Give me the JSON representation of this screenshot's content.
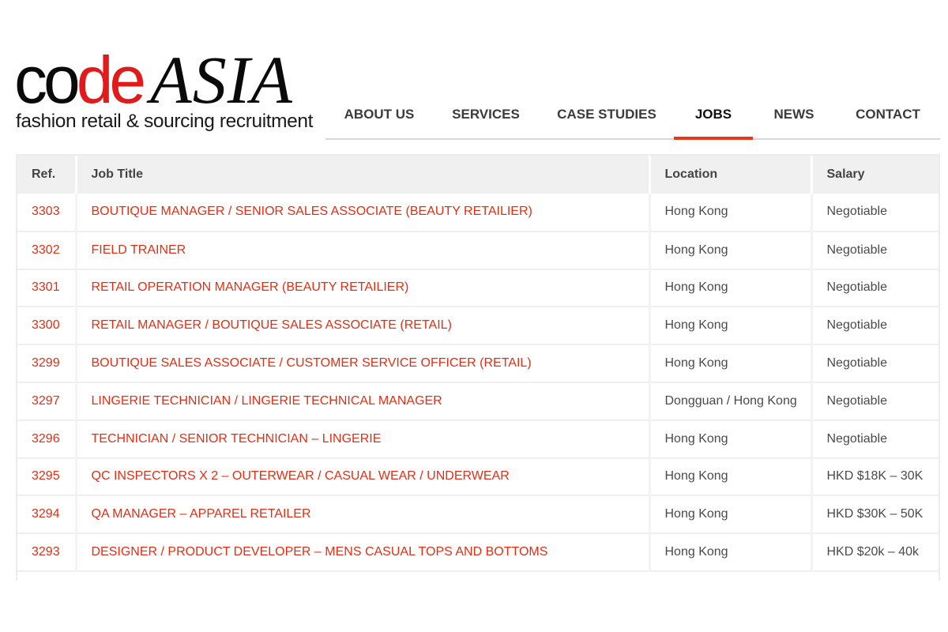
{
  "logo": {
    "code_part1": "co",
    "code_part2": "de",
    "asia": "ASIA",
    "tagline": "fashion retail & sourcing recruitment"
  },
  "nav": {
    "items": [
      {
        "label": "ABOUT US",
        "active": false
      },
      {
        "label": "SERVICES",
        "active": false
      },
      {
        "label": "CASE STUDIES",
        "active": false
      },
      {
        "label": "JOBS",
        "active": true
      },
      {
        "label": "NEWS",
        "active": false
      },
      {
        "label": "CONTACT",
        "active": false
      }
    ]
  },
  "colors": {
    "accent": "#e5391c",
    "link": "#e32e14",
    "header_bg": "#f0f0f0"
  },
  "jobs_table": {
    "headers": [
      "Ref.",
      "Job Title",
      "Location",
      "Salary"
    ],
    "rows": [
      {
        "ref": "3303",
        "title": "BOUTIQUE MANAGER / SENIOR SALES ASSOCIATE (BEAUTY RETAILIER)",
        "location": "Hong Kong",
        "salary": "Negotiable"
      },
      {
        "ref": "3302",
        "title": "FIELD TRAINER",
        "location": "Hong Kong",
        "salary": "Negotiable"
      },
      {
        "ref": "3301",
        "title": "RETAIL OPERATION MANAGER (BEAUTY RETAILIER)",
        "location": "Hong Kong",
        "salary": "Negotiable"
      },
      {
        "ref": "3300",
        "title": "RETAIL MANAGER / BOUTIQUE SALES ASSOCIATE (RETAIL)",
        "location": "Hong Kong",
        "salary": "Negotiable"
      },
      {
        "ref": "3299",
        "title": "BOUTIQUE SALES ASSOCIATE / CUSTOMER SERVICE OFFICER (RETAIL)",
        "location": "Hong Kong",
        "salary": "Negotiable"
      },
      {
        "ref": "3297",
        "title": "LINGERIE TECHNICIAN / LINGERIE TECHNICAL MANAGER",
        "location": "Dongguan / Hong Kong",
        "salary": "Negotiable"
      },
      {
        "ref": "3296",
        "title": "TECHNICIAN / SENIOR TECHNICIAN – LINGERIE",
        "location": "Hong Kong",
        "salary": "Negotiable"
      },
      {
        "ref": "3295",
        "title": "QC INSPECTORS X 2 – OUTERWEAR / CASUAL WEAR / UNDERWEAR",
        "location": "Hong Kong",
        "salary": "HKD $18K – 30K"
      },
      {
        "ref": "3294",
        "title": "QA MANAGER – APPAREL RETAILER",
        "location": "Hong Kong",
        "salary": "HKD $30K – 50K"
      },
      {
        "ref": "3293",
        "title": "DESIGNER / PRODUCT DEVELOPER – MENS CASUAL TOPS AND BOTTOMS",
        "location": "Hong Kong",
        "salary": "HKD $20k – 40k"
      }
    ]
  }
}
